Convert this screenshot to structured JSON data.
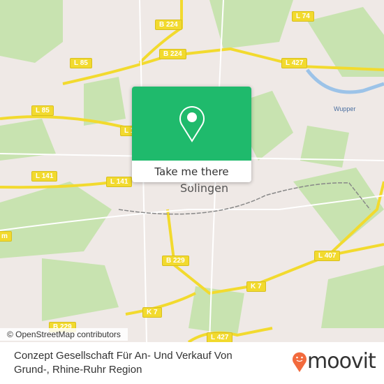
{
  "map": {
    "city_label": "Solingen",
    "river_label": "Wupper",
    "road_labels": [
      "B 224",
      "B 224",
      "L 74",
      "L 427",
      "L 85",
      "L 85",
      "L 141",
      "L 141",
      "L 1",
      "B 229",
      "K 7",
      "L 407",
      "K 7",
      "L 427",
      "B 229",
      "m"
    ],
    "attribution": "© OpenStreetMap contributors",
    "colors": {
      "land": "#efe9e6",
      "forest": "#c8e3b0",
      "road": "#f2da2e",
      "water": "#9cc3e8",
      "popup": "#1fba6c"
    }
  },
  "popup": {
    "icon": "map-pin-icon",
    "button_label": "Take me there"
  },
  "footer": {
    "title": "Conzept Gesellschaft Für An- Und Verkauf Von Grund-, Rhine-Ruhr Region",
    "logo_text": "moovit",
    "logo_color": "#f26a3d"
  }
}
